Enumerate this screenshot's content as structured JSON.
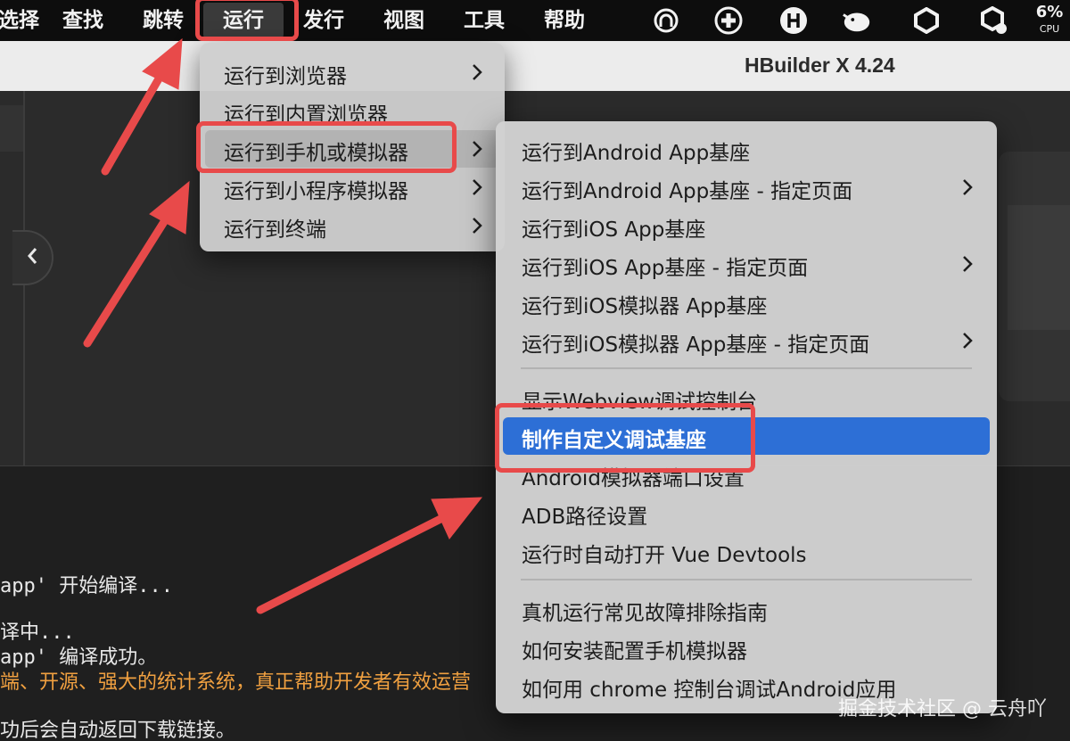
{
  "menubar": {
    "items": [
      "选择",
      "查找",
      "跳转",
      "运行",
      "发行",
      "视图",
      "工具",
      "帮助"
    ],
    "active_index": 3,
    "cpu": {
      "percent": "6%",
      "label": "CPU"
    },
    "tray_icons": [
      "headphones-icon",
      "add-circle-icon",
      "hbuilder-h-icon",
      "bird-icon",
      "hexagon-icon",
      "hexagon-clock-icon"
    ]
  },
  "window": {
    "title": "HBuilder X 4.24"
  },
  "run_menu": {
    "items": [
      {
        "label": "运行到浏览器",
        "submenu": true
      },
      {
        "label": "运行到内置浏览器",
        "submenu": false
      },
      {
        "label": "运行到手机或模拟器",
        "submenu": true,
        "highlighted": true
      },
      {
        "label": "运行到小程序模拟器",
        "submenu": true
      },
      {
        "label": "运行到终端",
        "submenu": true
      }
    ]
  },
  "device_submenu": {
    "groups": [
      [
        {
          "label": "运行到Android App基座",
          "submenu": false
        },
        {
          "label": "运行到Android App基座 - 指定页面",
          "submenu": true
        },
        {
          "label": "运行到iOS App基座",
          "submenu": false
        },
        {
          "label": "运行到iOS App基座 - 指定页面",
          "submenu": true
        },
        {
          "label": "运行到iOS模拟器 App基座",
          "submenu": false
        },
        {
          "label": "运行到iOS模拟器 App基座 - 指定页面",
          "submenu": true
        }
      ],
      [
        {
          "label": "显示Webview调试控制台",
          "submenu": false
        },
        {
          "label": "制作自定义调试基座",
          "submenu": false,
          "selected": true
        },
        {
          "label": "Android模拟器端口设置",
          "submenu": false
        },
        {
          "label": "ADB路径设置",
          "submenu": false
        },
        {
          "label": "运行时自动打开 Vue Devtools",
          "submenu": false
        }
      ],
      [
        {
          "label": "真机运行常见故障排除指南",
          "submenu": false
        },
        {
          "label": "如何安装配置手机模拟器",
          "submenu": false
        },
        {
          "label": "如何用 chrome 控制台调试Android应用",
          "submenu": false
        }
      ]
    ]
  },
  "console": {
    "lines": [
      {
        "text": "app' 开始编译...",
        "color": "white"
      },
      {
        "text": "译中...",
        "color": "white"
      },
      {
        "text": "app' 编译成功。",
        "color": "white"
      },
      {
        "text": "端、开源、强大的统计系统，真正帮助开发者有效运营",
        "color": "orange"
      },
      {
        "text": "功后会自动返回下载链接。",
        "color": "white"
      }
    ]
  },
  "watermark": "掘金技术社区 @ 云舟吖",
  "colors": {
    "annotation_red": "#e84a4a",
    "selection_blue": "#2d6fd6",
    "console_orange": "#f0a040"
  }
}
